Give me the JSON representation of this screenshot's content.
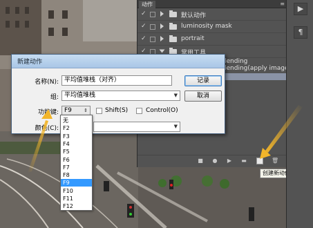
{
  "actions_panel": {
    "tab_label": "动作",
    "rows": [
      {
        "label": "默认动作",
        "kind": "set"
      },
      {
        "label": "luminosity mask",
        "kind": "set"
      },
      {
        "label": "portrait",
        "kind": "set"
      },
      {
        "label": "常用工具",
        "kind": "set"
      },
      {
        "label": "lending",
        "kind": "action"
      },
      {
        "label": "lending(apply image...",
        "kind": "action"
      }
    ],
    "toolbar": {
      "stop": "stop-icon",
      "record": "record-icon",
      "play": "play-icon",
      "new_set": "folder-icon",
      "new_action": "new-action-icon",
      "delete": "trash-icon"
    },
    "tooltip": "创建新动作"
  },
  "dialog": {
    "title": "新建动作",
    "name_label": "名称(N):",
    "name_value": "平均值堆栈（对齐）",
    "set_label": "组:",
    "set_value": "平均值堆栈",
    "function_key_label": "功能键:",
    "function_key_value": "F9",
    "shift_label": "Shift(S)",
    "control_label": "Control(O)",
    "color_label": "颜色(C):",
    "record_button": "记录",
    "cancel_button": "取消"
  },
  "function_key_options": [
    "无",
    "F2",
    "F3",
    "F4",
    "F5",
    "F6",
    "F7",
    "F8",
    "F9",
    "F10",
    "F11",
    "F12"
  ],
  "function_key_selected": "F9",
  "colors": {
    "highlight": "#3399ff",
    "arrow": "#f2b52a",
    "panel": "#535353"
  }
}
